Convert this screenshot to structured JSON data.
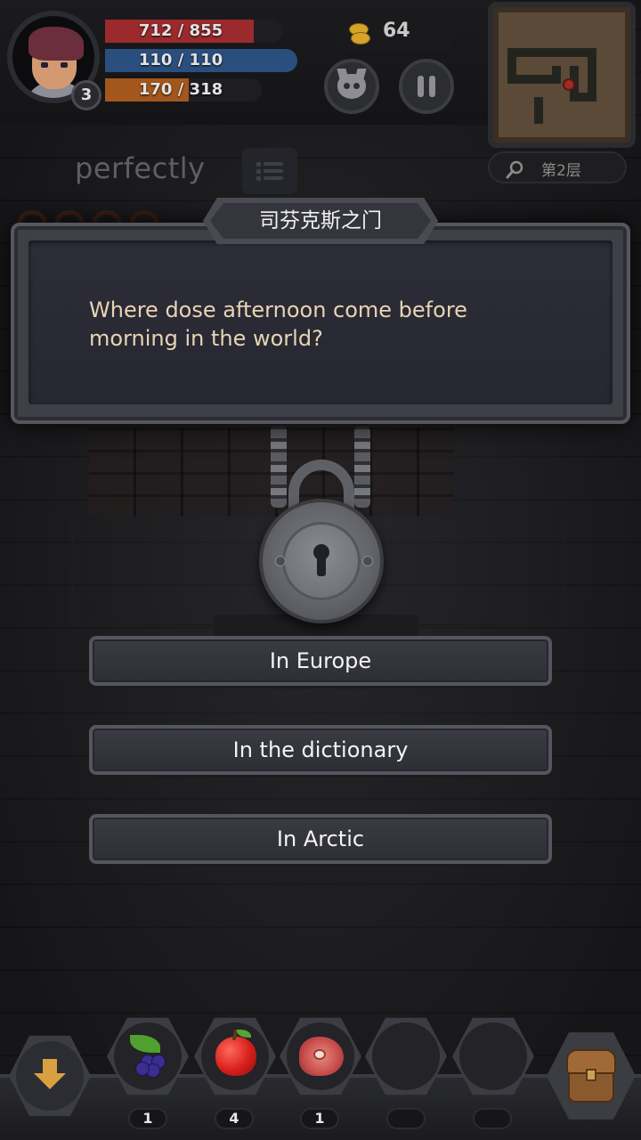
{
  "hud": {
    "level": "3",
    "hp": {
      "text": "712 / 855",
      "fraction": 0.833
    },
    "mp": {
      "text": "110 / 110",
      "fraction": 1.0
    },
    "xp": {
      "text": "170 / 318",
      "fraction": 0.535
    },
    "gold": "64",
    "floor_label": "第2层"
  },
  "combo_word": "perfectly",
  "dialog": {
    "title": "司芬克斯之门",
    "question": "Where dose afternoon come before morning in the world?"
  },
  "answers": [
    "In Europe",
    "In the dictionary",
    "In Arctic"
  ],
  "inventory": [
    {
      "icon": "berries-icon",
      "count": "1"
    },
    {
      "icon": "apple-icon",
      "count": "4"
    },
    {
      "icon": "meat-icon",
      "count": "1"
    },
    {
      "icon": "empty-slot",
      "count": ""
    },
    {
      "icon": "empty-slot",
      "count": ""
    }
  ],
  "colors": {
    "hp": "#9b2a2d",
    "mp": "#2a4f7e",
    "xp": "#a3571c",
    "question_text": "#e8d4b4",
    "panel": "#2c2d37"
  }
}
